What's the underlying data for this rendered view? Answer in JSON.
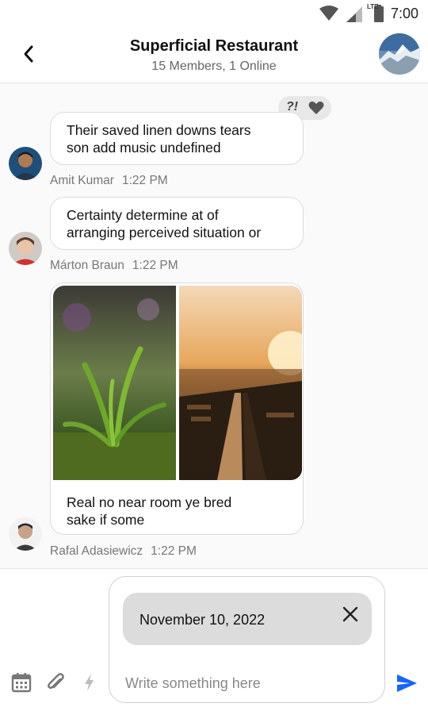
{
  "status_bar": {
    "time": "7:00",
    "network": "LTE",
    "icons": [
      "wifi-icon",
      "signal-icon",
      "battery-icon"
    ]
  },
  "header": {
    "title": "Superficial Restaurant",
    "subtitle": "15 Members, 1 Online",
    "icons": [
      "back-arrow-icon",
      "group-avatar"
    ]
  },
  "messages": [
    {
      "lines": [
        "Their saved linen downs tears",
        "son add music undefined"
      ],
      "sender": "Amit Kumar",
      "time": "1:22 PM",
      "reactions": {
        "text": "?!",
        "icon": "heart-icon"
      }
    },
    {
      "lines": [
        "Certainty determine at of",
        "arranging perceived situation or"
      ],
      "sender": "Márton Braun",
      "time": "1:22 PM"
    },
    {
      "images": [
        "plant-photo",
        "city-train-photo"
      ],
      "lines": [
        "Real no near room ye bred",
        "sake if some"
      ],
      "sender": "Rafal Adasiewicz",
      "time": "1:22 PM"
    }
  ],
  "composer": {
    "date_chip": "November 10, 2022",
    "placeholder": "Write something here",
    "tools": [
      "calendar-icon",
      "paperclip-icon",
      "lightning-icon",
      "send-icon"
    ]
  },
  "colors": {
    "accent": "#1565ff",
    "bubble_border": "#dcdcdc",
    "chip_bg": "#dcdcdc"
  }
}
